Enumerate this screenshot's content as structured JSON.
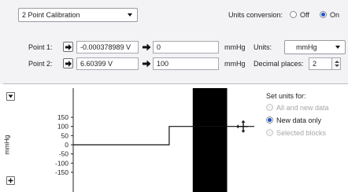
{
  "calibration": {
    "mode_value": "2 Point Calibration",
    "units_conversion_label": "Units conversion:",
    "off_label": "Off",
    "on_label": "On",
    "units_conversion_selected": "On",
    "point1": {
      "label": "Point 1:",
      "input_value": "-0.000378989 V",
      "output_value": "0",
      "unit": "mmHg"
    },
    "point2": {
      "label": "Point 2:",
      "input_value": "6.60399 V",
      "output_value": "100",
      "unit": "mmHg"
    },
    "units_label": "Units:",
    "units_value": "mmHg",
    "decimal_label": "Decimal places:",
    "decimal_value": "2"
  },
  "preview": {
    "y_axis_label": "mmHg",
    "y_ticks": [
      "150",
      "100",
      "50",
      "0",
      "-50",
      "-100",
      "-150"
    ],
    "set_units_title": "Set units for:",
    "options": [
      {
        "label": "All and new data",
        "selected": false,
        "disabled": true
      },
      {
        "label": "New data only",
        "selected": true,
        "disabled": false
      },
      {
        "label": "Selected blocks",
        "selected": false,
        "disabled": true
      }
    ]
  },
  "chart_data": {
    "type": "line",
    "ylabel": "mmHg",
    "ylim": [
      -165,
      170
    ],
    "yticks": [
      150,
      100,
      50,
      0,
      -50,
      -100,
      -150
    ],
    "series": [
      {
        "x": [
          0,
          0.53,
          0.53,
          1.0
        ],
        "values": [
          0,
          0,
          100,
          100
        ]
      }
    ],
    "highlight_block": {
      "x_start": 0.66,
      "x_end": 0.85
    }
  },
  "colors": {
    "panel_bg": "#f3f3f5",
    "radio_selected": "#1a56c8",
    "block": "#000000",
    "disabled_text": "#a7a7aa"
  }
}
